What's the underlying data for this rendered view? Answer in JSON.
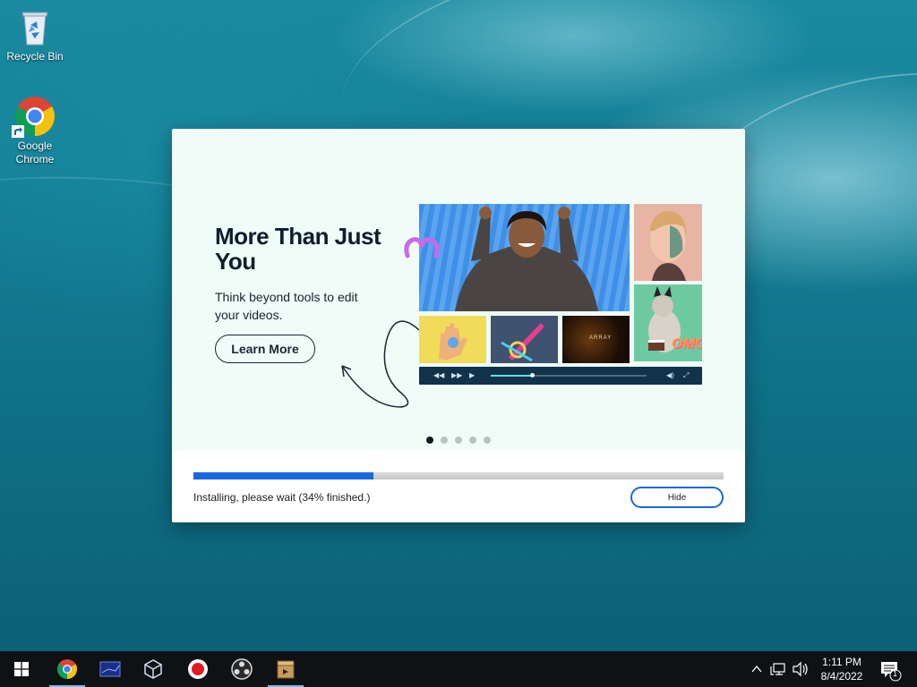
{
  "desktop": {
    "icons": [
      {
        "label": "Recycle Bin"
      },
      {
        "label": "Google Chrome"
      }
    ]
  },
  "installer": {
    "slide": {
      "title": "More Than Just You",
      "description": "Think beyond tools to edit your videos.",
      "learn_more_label": "Learn More",
      "sticker_text": "OMG!",
      "tile_text": "ARRAY"
    },
    "carousel": {
      "total": 5,
      "active_index": 0
    },
    "progress": {
      "percent": 34,
      "status_text": "Installing, please wait (34% finished.)"
    },
    "hide_label": "Hide",
    "accent_color": "#1769e0"
  },
  "taskbar": {
    "apps": [
      {
        "icon": "windows-start-icon"
      },
      {
        "icon": "chrome-icon"
      },
      {
        "icon": "terminal-icon"
      },
      {
        "icon": "virtualbox-icon"
      },
      {
        "icon": "screen-recorder-icon"
      },
      {
        "icon": "obs-icon"
      },
      {
        "icon": "installer-icon"
      }
    ],
    "clock": {
      "time": "1:11 PM",
      "date": "8/4/2022"
    },
    "notification_count": "1"
  }
}
